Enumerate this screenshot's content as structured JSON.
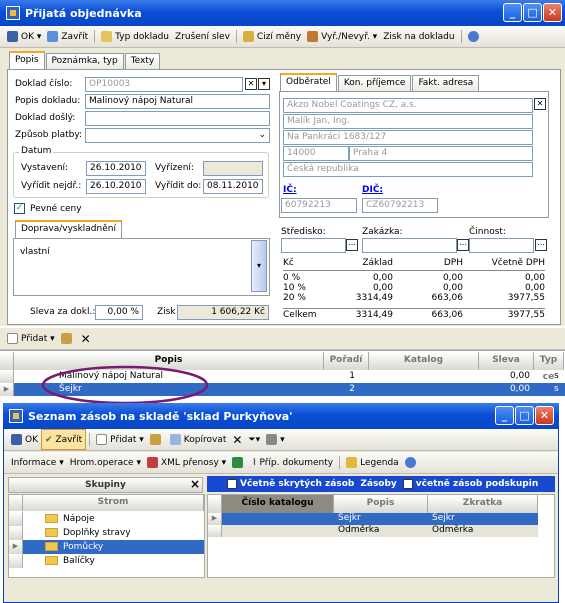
{
  "main_window": {
    "title": "Přijatá objednávka",
    "min": "_",
    "max": "□",
    "close": "✕"
  },
  "toolbar": [
    "OK",
    "Zavřít",
    "Typ dokladu",
    "Zrušení slev",
    "Cizí měny",
    "Vyř./Nevyř.",
    "Zisk na dokladu"
  ],
  "tabs": [
    "Popis",
    "Poznámka, typ",
    "Texty"
  ],
  "form": {
    "doklad_cislo_label": "Doklad číslo:",
    "doklad_cislo": "OP10003",
    "popis_label": "Popis dokladu:",
    "popis": "Malinový nápoj Natural",
    "doklad_dosly_label": "Doklad došlý:",
    "zpusob_label": "Způsob platby:",
    "datum_label": "Datum",
    "vystaveni_label": "Vystavení:",
    "vystaveni": "26.10.2010",
    "vyrizeni_label": "Vyřízení:",
    "vyridit_nejdr_label": "Vyřídit nejdř.:",
    "vyridit_nejdr": "26.10.2010",
    "vyridit_do_label": "Vyřídit do:",
    "vyridit_do": "08.11.2010",
    "pevne_ceny": "Pevné ceny",
    "doprava_tab": "Doprava/vyskladnění",
    "doprava_text": "vlastní",
    "sleva_label": "Sleva za dokl.:",
    "sleva": "0,00 %",
    "zisk_label": "Zisk",
    "zisk": "1 606,22 Kč"
  },
  "partner_tabs": [
    "Odběratel",
    "Kon. příjemce",
    "Fakt. adresa"
  ],
  "partner": {
    "firma": "Akzo Nobel Coatings CZ, a.s.",
    "osoba": "Malík Jan, Ing.",
    "ulice": "Na Pankráci 1683/127",
    "psc": "14000",
    "mesto": "Praha 4",
    "stat": "Česká republika",
    "ic_label": "IČ:",
    "ic": "60792213",
    "dic_label": "DIČ:",
    "dic": "CZ60792213"
  },
  "strediska": {
    "stredisko": "Středisko:",
    "zakazka": "Zakázka:",
    "cinnost": "Činnost:"
  },
  "summary": {
    "headers": [
      "Kč",
      "Základ",
      "DPH",
      "Včetně DPH"
    ],
    "rows": [
      [
        "0 %",
        "0,00",
        "0,00",
        "0,00"
      ],
      [
        "10 %",
        "0,00",
        "0,00",
        "0,00"
      ],
      [
        "20 %",
        "3314,49",
        "663,06",
        "3977,55"
      ],
      [
        "Celkem",
        "3314,49",
        "663,06",
        "3977,55"
      ]
    ]
  },
  "items_toolbar": {
    "pridat": "Přidat"
  },
  "items_grid": {
    "headers": [
      "Popis",
      "Pořadí",
      "Katalog",
      "Sleva",
      "Typ ce"
    ],
    "rows": [
      {
        "popis": "Malinový nápoj Natural",
        "poradi": "1",
        "sleva": "0,00",
        "typ": "s"
      },
      {
        "popis": "Šejkr",
        "poradi": "2",
        "sleva": "0,00",
        "typ": "s"
      }
    ]
  },
  "stock_window": {
    "title": "Seznam zásob na skladě 'sklad Purkyňova'",
    "toolbar1": [
      "OK",
      "Zavřít",
      "Přidat",
      "Kopírovat"
    ],
    "toolbar2": [
      "Informace",
      "Hrom.operace",
      "XML přenosy",
      "Příp. dokumenty",
      "Legenda"
    ],
    "groups_header": "Skupiny",
    "close_x": "×",
    "vcetne_skrytych": "Včetně skrytých zásob",
    "zasoby": "Zásoby",
    "vcetne_podskupin": "včetně zásob podskupin",
    "tree_header": "Strom",
    "tree": [
      "Nápoje",
      "Doplňky stravy",
      "Pomůcky",
      "Balíčky"
    ],
    "stock_headers": [
      "Číslo katalogu",
      "Popis",
      "Zkratka"
    ],
    "stock_rows": [
      [
        "",
        "Šejkr",
        "Šejkr"
      ],
      [
        "",
        "Odměrka",
        "Odměrka"
      ]
    ]
  }
}
